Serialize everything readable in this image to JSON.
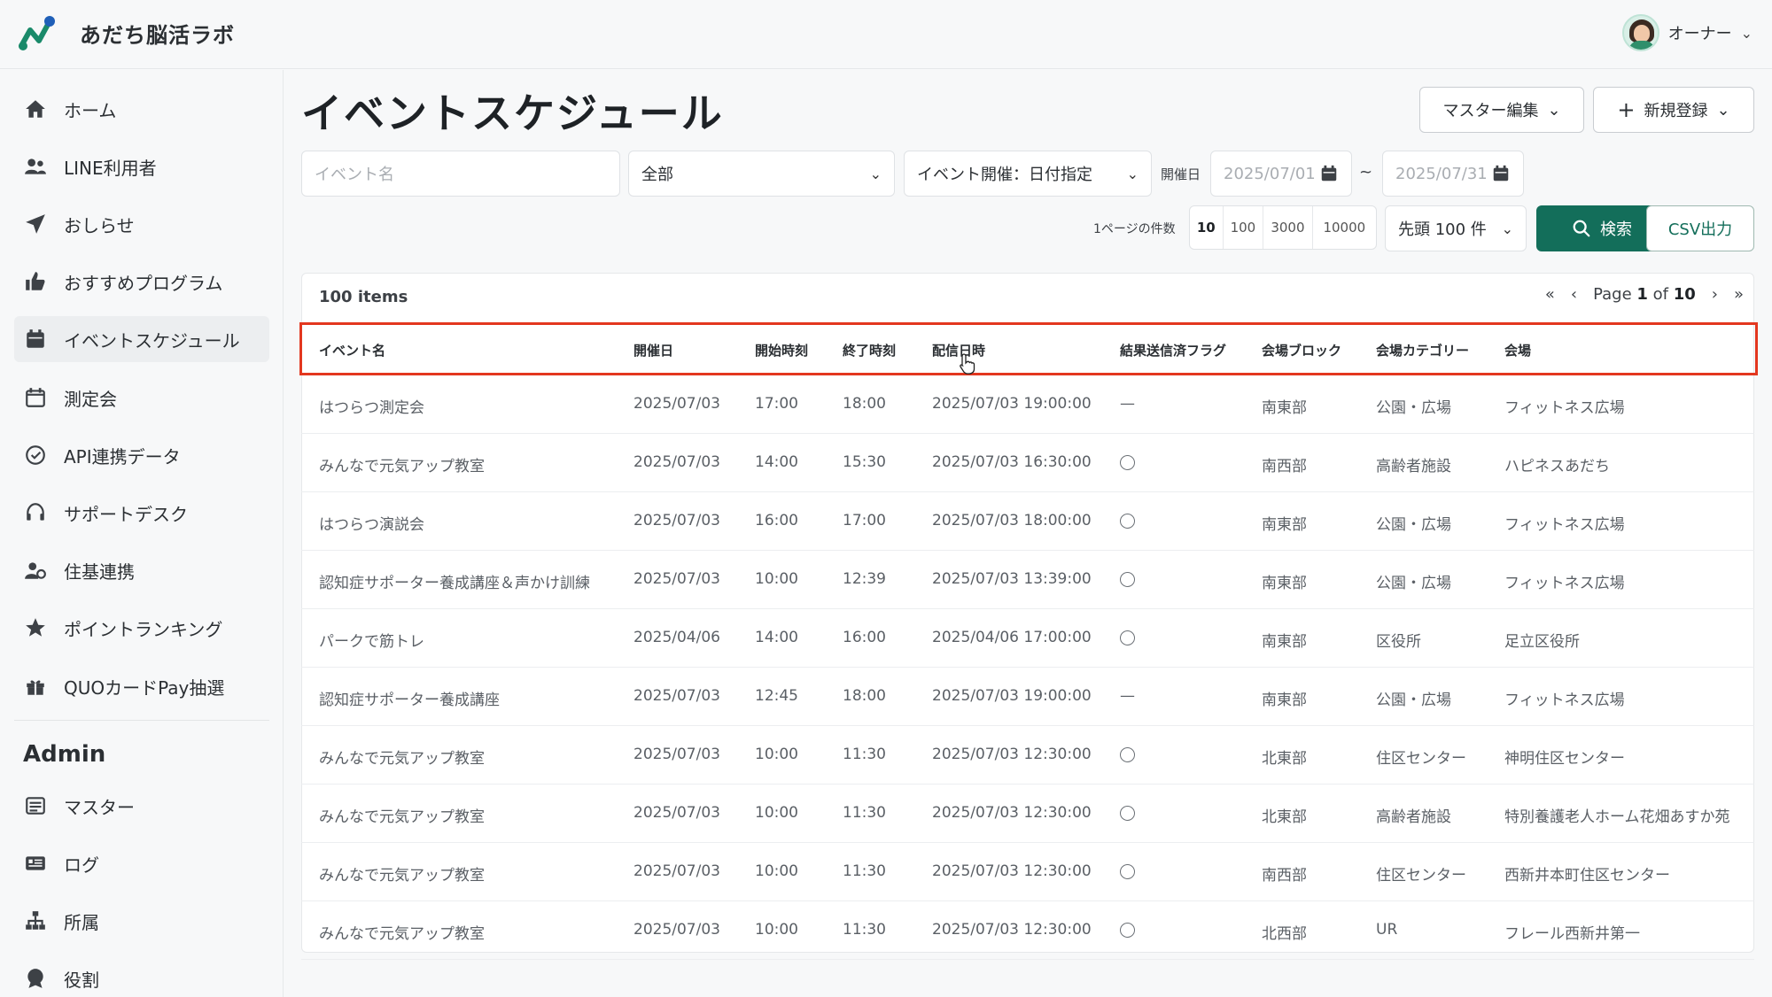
{
  "header": {
    "brand": "あだち脳活ラボ",
    "user_name": "オーナー"
  },
  "sidebar": {
    "items": [
      {
        "label": "ホーム",
        "icon": "home-icon"
      },
      {
        "label": "LINE利用者",
        "icon": "users-icon"
      },
      {
        "label": "おしらせ",
        "icon": "paper-plane-icon"
      },
      {
        "label": "おすすめプログラム",
        "icon": "thumbs-up-icon"
      },
      {
        "label": "イベントスケジュール",
        "icon": "calendar-icon"
      },
      {
        "label": "測定会",
        "icon": "calendar-outline-icon"
      },
      {
        "label": "API連携データ",
        "icon": "api-icon"
      },
      {
        "label": "サポートデスク",
        "icon": "headset-icon"
      },
      {
        "label": "住基連携",
        "icon": "user-gear-icon"
      },
      {
        "label": "ポイントランキング",
        "icon": "star-icon"
      },
      {
        "label": "QUOカードPay抽選",
        "icon": "gift-icon"
      }
    ],
    "admin_title": "Admin",
    "admin_items": [
      {
        "label": "マスター",
        "icon": "list-icon"
      },
      {
        "label": "ログ",
        "icon": "log-icon"
      },
      {
        "label": "所属",
        "icon": "org-icon"
      },
      {
        "label": "役割",
        "icon": "badge-icon"
      }
    ]
  },
  "main": {
    "title": "イベントスケジュール",
    "master_edit_label": "マスター編集",
    "new_register_label": "新規登録",
    "filters": {
      "event_name_placeholder": "イベント名",
      "category_value": "全部",
      "date_mode_value": "イベント開催：日付指定",
      "date_label": "開催日",
      "date_from": "2025/07/01",
      "tilde": "~",
      "date_to": "2025/07/31",
      "per_page_label": "1ページの件数",
      "per_page_options": [
        "10",
        "100",
        "3000",
        "10000"
      ],
      "limit_value": "先頭 100 件",
      "search_label": "検索",
      "csv_label": "CSV出力"
    },
    "table": {
      "items_count": "100 items",
      "page_prefix": "Page ",
      "page_current": "1",
      "page_mid": " of ",
      "page_total": "10",
      "columns": [
        "イベント名",
        "開催日",
        "開始時刻",
        "終了時刻",
        "配信日時",
        "結果送信済フラグ",
        "会場ブロック",
        "会場カテゴリー",
        "会場"
      ],
      "rows": [
        [
          "はつらつ測定会",
          "2025/07/03",
          "17:00",
          "18:00",
          "2025/07/03 19:00:00",
          "—",
          "南東部",
          "公園・広場",
          "フィットネス広場"
        ],
        [
          "みんなで元気アップ教室",
          "2025/07/03",
          "14:00",
          "15:30",
          "2025/07/03 16:30:00",
          "○",
          "南西部",
          "高齢者施設",
          "ハピネスあだち"
        ],
        [
          "はつらつ演説会",
          "2025/07/03",
          "16:00",
          "17:00",
          "2025/07/03 18:00:00",
          "○",
          "南東部",
          "公園・広場",
          "フィットネス広場"
        ],
        [
          "認知症サポーター養成講座＆声かけ訓練",
          "2025/07/03",
          "10:00",
          "12:39",
          "2025/07/03 13:39:00",
          "○",
          "南東部",
          "公園・広場",
          "フィットネス広場"
        ],
        [
          "パークで筋トレ",
          "2025/04/06",
          "14:00",
          "16:00",
          "2025/04/06 17:00:00",
          "○",
          "南東部",
          "区役所",
          "足立区役所"
        ],
        [
          "認知症サポーター養成講座",
          "2025/07/03",
          "12:45",
          "18:00",
          "2025/07/03 19:00:00",
          "—",
          "南東部",
          "公園・広場",
          "フィットネス広場"
        ],
        [
          "みんなで元気アップ教室",
          "2025/07/03",
          "10:00",
          "11:30",
          "2025/07/03 12:30:00",
          "○",
          "北東部",
          "住区センター",
          "神明住区センター"
        ],
        [
          "みんなで元気アップ教室",
          "2025/07/03",
          "10:00",
          "11:30",
          "2025/07/03 12:30:00",
          "○",
          "北東部",
          "高齢者施設",
          "特別養護老人ホーム花畑あすか苑"
        ],
        [
          "みんなで元気アップ教室",
          "2025/07/03",
          "10:00",
          "11:30",
          "2025/07/03 12:30:00",
          "○",
          "南西部",
          "住区センター",
          "西新井本町住区センター"
        ],
        [
          "みんなで元気アップ教室",
          "2025/07/03",
          "10:00",
          "11:30",
          "2025/07/03 12:30:00",
          "○",
          "北西部",
          "UR",
          "フレール西新井第一"
        ]
      ]
    }
  },
  "colors": {
    "accent": "#136e5a",
    "highlight": "#e3371f"
  }
}
